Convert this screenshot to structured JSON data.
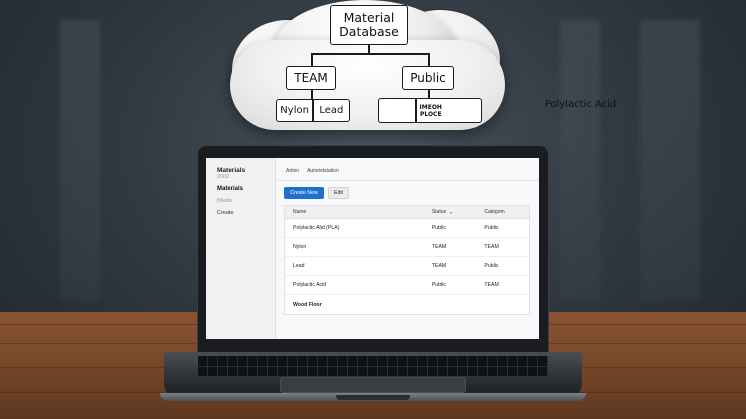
{
  "diagram": {
    "root": "Material Database",
    "team": "TEAM",
    "public": "Public",
    "team_children": [
      "Nylon",
      "Lead"
    ],
    "public_child": "Polylactic Acid",
    "public_tag": "IMEOH PLOCE"
  },
  "sidebar": {
    "title": "Materials",
    "year": "2002",
    "items": [
      {
        "label": "Materials",
        "active": true
      },
      {
        "label": "|Made",
        "active": false
      },
      {
        "label": "Create",
        "active": false
      }
    ]
  },
  "tabs": [
    "Artien",
    "Autorielstation"
  ],
  "toolbar": {
    "create_label": "Create New",
    "edit_label": "Edit"
  },
  "table": {
    "columns": [
      "Name",
      "Status",
      "Categom"
    ],
    "rows": [
      {
        "name": "Polylactic Alid (PLA)",
        "status": "Public",
        "category": "Public"
      },
      {
        "name": "Nylon",
        "status": "TEAM",
        "category": "TEAM"
      },
      {
        "name": "Lead",
        "status": "TEAM",
        "category": "Public"
      },
      {
        "name": "Polylactic Acid",
        "status": "Public",
        "category": "TEAM"
      },
      {
        "name": "Wood Floor",
        "status": "",
        "category": ""
      }
    ]
  },
  "colors": {
    "primary_button": "#1f6fd1",
    "desk": "#7a4a2c",
    "laptop_body": "#1a1c1f"
  },
  "icons": {
    "sort": "sort-caret-icon"
  }
}
